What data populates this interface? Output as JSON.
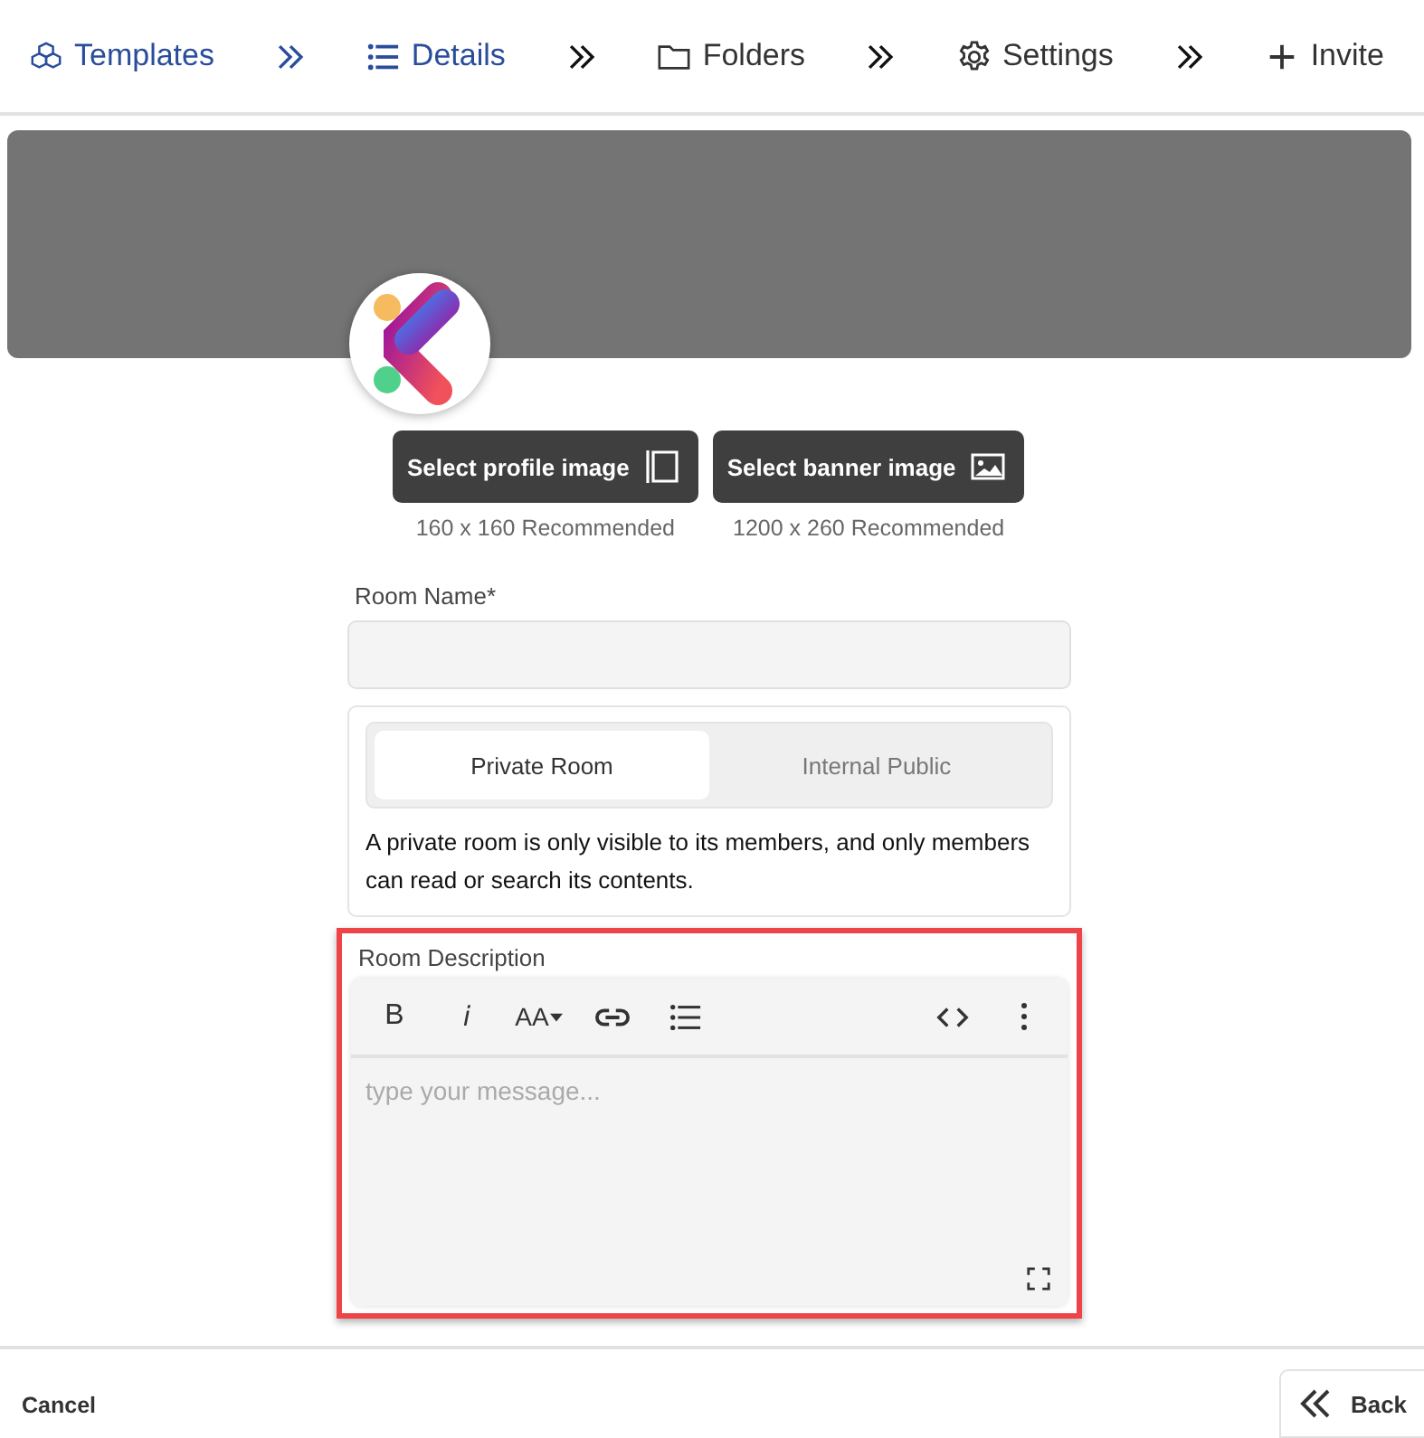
{
  "steps": [
    {
      "kind": "templates",
      "label": "Templates",
      "highlighted": true
    },
    {
      "kind": "details",
      "label": "Details",
      "highlighted": true
    },
    {
      "kind": "folders",
      "label": "Folders",
      "highlighted": false
    },
    {
      "kind": "settings",
      "label": "Settings",
      "highlighted": false
    },
    {
      "kind": "invite",
      "label": "Invite",
      "highlighted": false
    }
  ],
  "image_buttons": [
    {
      "kind": "profile",
      "label": "Select profile image",
      "hint": "160 x 160 Recommended"
    },
    {
      "kind": "banner",
      "label": "Select banner image",
      "hint": "1200 x 260 Recommended"
    }
  ],
  "room_name": {
    "label": "Room Name*"
  },
  "visibility": {
    "options": [
      {
        "label": "Private Room",
        "selected": true
      },
      {
        "label": "Internal Public",
        "selected": false
      }
    ],
    "description": "A private room is only visible to its members, and only members can read or search its contents."
  },
  "room_description": {
    "label": "Room Description",
    "highlighted": true,
    "placeholder": "type your message...",
    "toolbar": [
      {
        "kind": "bold",
        "label": "B"
      },
      {
        "kind": "italic",
        "label": "i"
      },
      {
        "kind": "font-size",
        "label": "AA"
      },
      {
        "kind": "link"
      },
      {
        "kind": "list"
      },
      {
        "kind": "code"
      },
      {
        "kind": "more"
      }
    ]
  },
  "footer": {
    "cancel": "Cancel",
    "back": "Back"
  }
}
